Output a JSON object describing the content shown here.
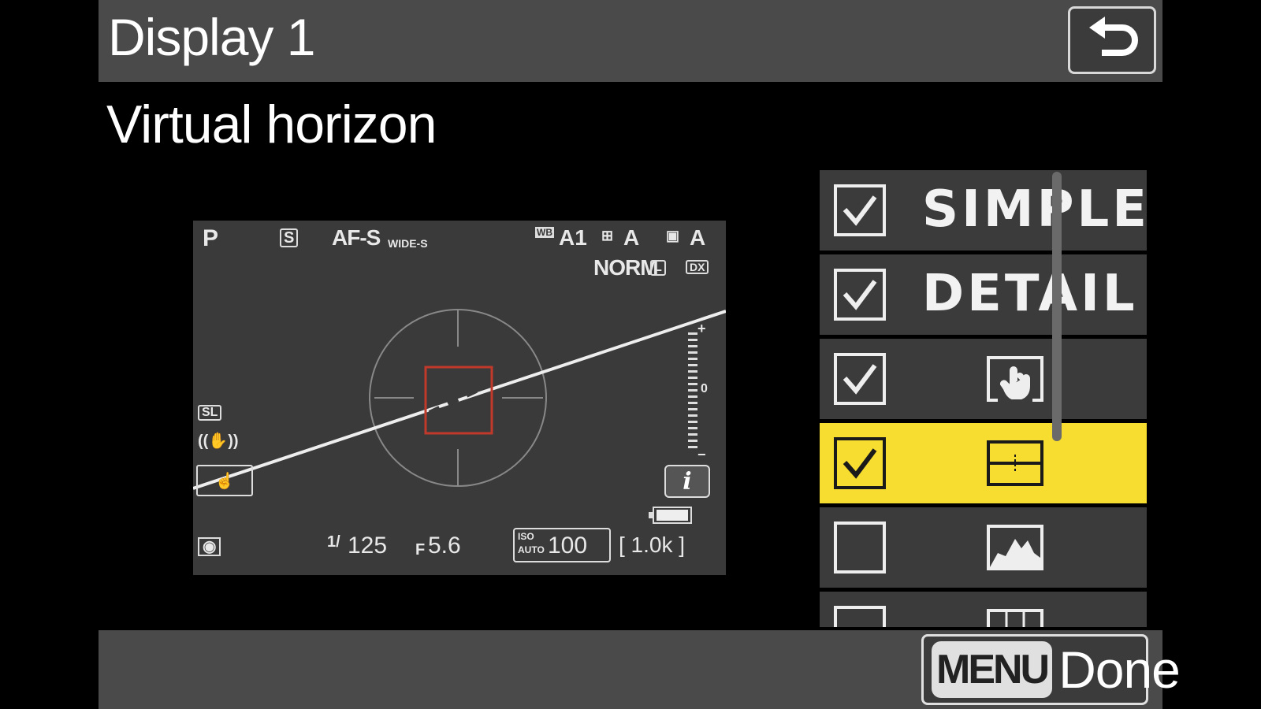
{
  "header": {
    "title": "Display 1"
  },
  "subtitle": "Virtual horizon",
  "preview": {
    "mode": "P",
    "release_mode": "S",
    "focus_mode": "AF-S",
    "area_mode": "WIDE-S",
    "wb": "A1",
    "picture_control": "A",
    "adl": "A",
    "image_quality": "NORM",
    "image_size": "L",
    "crop": "DX",
    "silent": "SL",
    "shutter_prefix": "1/",
    "shutter": "125",
    "aperture_prefix": "F",
    "aperture": "5.6",
    "iso_top": "ISO",
    "iso_bottom": "AUTO",
    "iso": "100",
    "shots": "[ 1.0k ]",
    "info_button": "i",
    "exposure_plus": "+",
    "exposure_zero": "0",
    "exposure_minus": "−"
  },
  "list": {
    "items": [
      {
        "label": "SIMPLE",
        "checked": true
      },
      {
        "label": "DETAIL",
        "checked": true
      },
      {
        "icon": "touch-hand-icon",
        "checked": true
      },
      {
        "icon": "virtual-horizon-icon",
        "checked": true,
        "selected": true
      },
      {
        "icon": "histogram-icon",
        "checked": false
      },
      {
        "icon": "grid-icon",
        "checked": false
      }
    ]
  },
  "footer": {
    "menu_badge": "MENU",
    "done_label": "Done"
  },
  "colors": {
    "highlight": "#f7dd2f",
    "af_frame": "#c0392b"
  }
}
